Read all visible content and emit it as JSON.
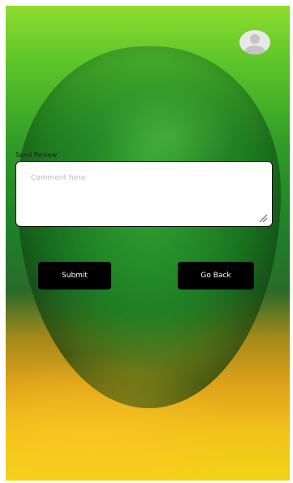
{
  "review": {
    "label": "Send Review",
    "comment_value": "",
    "comment_placeholder": "Comment here"
  },
  "actions": {
    "submit_label": "Submit",
    "back_label": "Go Back"
  },
  "icons": {
    "profile": "user-avatar-icon",
    "grip": "resize-grip-icon"
  },
  "colors": {
    "button_bg": "#000000",
    "button_text": "#ffffff",
    "field_bg": "#ffffff"
  }
}
